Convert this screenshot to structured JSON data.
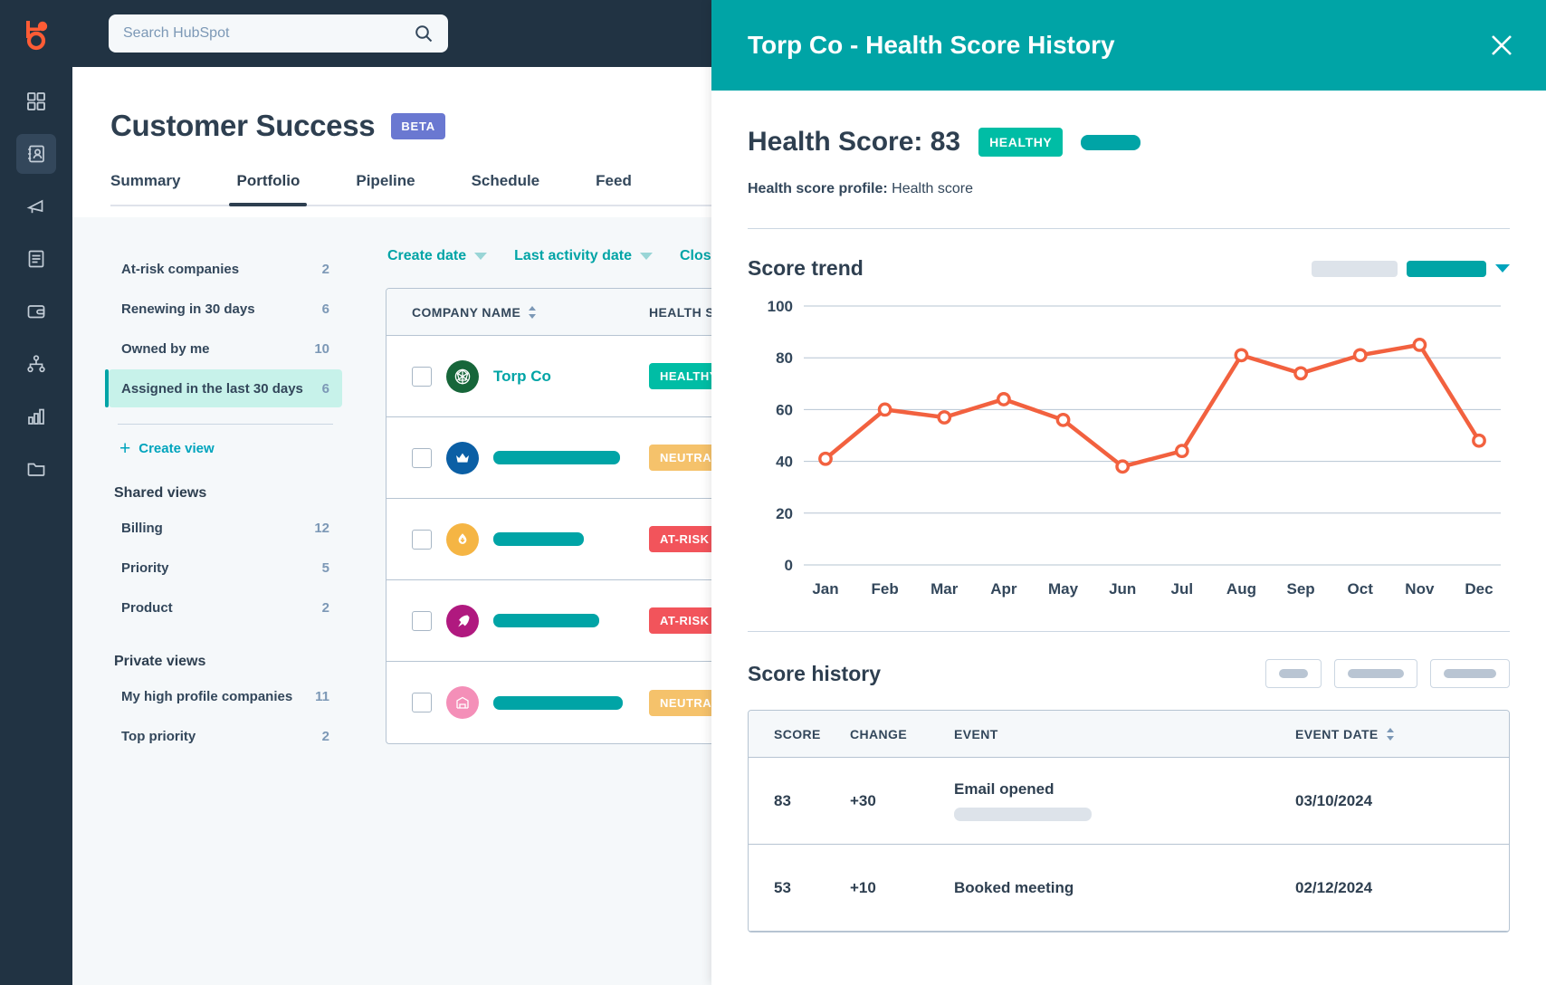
{
  "rail": {
    "logo": "hubspot-logo",
    "items": [
      {
        "name": "dashboard-icon",
        "label": "Dashboard"
      },
      {
        "name": "contacts-icon",
        "label": "Contacts"
      },
      {
        "name": "marketing-megaphone-icon",
        "label": "Marketing"
      },
      {
        "name": "content-icon",
        "label": "Content"
      },
      {
        "name": "commerce-wallet-icon",
        "label": "Commerce"
      },
      {
        "name": "automation-icon",
        "label": "Automation"
      },
      {
        "name": "reporting-bar-chart-icon",
        "label": "Reporting"
      },
      {
        "name": "library-folder-icon",
        "label": "Library"
      }
    ]
  },
  "search": {
    "placeholder": "Search HubSpot",
    "value": ""
  },
  "header": {
    "title": "Customer Success",
    "badge": "BETA"
  },
  "tabs": [
    {
      "label": "Summary",
      "active": false
    },
    {
      "label": "Portfolio",
      "active": true
    },
    {
      "label": "Pipeline",
      "active": false
    },
    {
      "label": "Schedule",
      "active": false
    },
    {
      "label": "Feed",
      "active": false
    }
  ],
  "views": {
    "standard": [
      {
        "label": "At-risk companies",
        "count": "2",
        "selected": false
      },
      {
        "label": "Renewing in 30 days",
        "count": "6",
        "selected": false
      },
      {
        "label": "Owned by me",
        "count": "10",
        "selected": false
      },
      {
        "label": "Assigned in the last 30 days",
        "count": "6",
        "selected": true
      }
    ],
    "create_view": "Create view",
    "shared_title": "Shared views",
    "shared": [
      {
        "label": "Billing",
        "count": "12"
      },
      {
        "label": "Priority",
        "count": "5"
      },
      {
        "label": "Product",
        "count": "2"
      }
    ],
    "private_title": "Private views",
    "private": [
      {
        "label": "My high profile companies",
        "count": "11"
      },
      {
        "label": "Top priority",
        "count": "2"
      }
    ]
  },
  "filters": [
    {
      "label": "Create date"
    },
    {
      "label": "Last activity date"
    },
    {
      "label": "Close date"
    }
  ],
  "table": {
    "columns": [
      {
        "label": "COMPANY NAME",
        "sortable": true
      },
      {
        "label": "HEALTH STATUS",
        "sortable": false
      }
    ],
    "rows": [
      {
        "company": "Torp Co",
        "redacted": false,
        "redact_width": 0,
        "avatar_color": "#17663a",
        "avatar_glyph": "◈",
        "status": "HEALTHY",
        "status_class": "healthy"
      },
      {
        "company": "",
        "redacted": true,
        "redact_width": 140,
        "avatar_color": "#0b5fa5",
        "avatar_glyph": "♛",
        "status": "NEUTRAL",
        "status_class": "neutral"
      },
      {
        "company": "",
        "redacted": true,
        "redact_width": 100,
        "avatar_color": "#f5b544",
        "avatar_glyph": "◉",
        "status": "AT-RISK",
        "status_class": "atrisk"
      },
      {
        "company": "",
        "redacted": true,
        "redact_width": 117,
        "avatar_color": "#b0197f",
        "avatar_glyph": "➤",
        "status": "AT-RISK",
        "status_class": "atrisk"
      },
      {
        "company": "",
        "redacted": true,
        "redact_width": 143,
        "avatar_color": "#f48fb8",
        "avatar_glyph": "▦",
        "status": "NEUTRAL",
        "status_class": "neutral"
      }
    ]
  },
  "panel": {
    "title": "Torp Co - Health Score History",
    "close_icon": "close-icon",
    "score_label": "Health Score: 83",
    "score_pill": "HEALTHY",
    "profile_label": "Health score profile:",
    "profile_value": "Health score",
    "trend_title": "Score trend",
    "history_title": "Score history",
    "history_columns": [
      {
        "label": "SCORE"
      },
      {
        "label": "CHANGE"
      },
      {
        "label": "EVENT"
      },
      {
        "label": "EVENT DATE",
        "sortable": true
      }
    ],
    "history_rows": [
      {
        "score": "83",
        "change": "+30",
        "event": "Email opened",
        "date": "03/10/2024",
        "redacted_sub": true
      },
      {
        "score": "53",
        "change": "+10",
        "event": "Booked meeting",
        "date": "02/12/2024",
        "redacted_sub": false
      }
    ]
  },
  "colors": {
    "teal": "#00a4a6",
    "healthy": "#00bda5",
    "neutral": "#f5c26b",
    "atrisk": "#f2545b",
    "beta": "#6a78d1",
    "line": "#f2613f",
    "navy": "#213343"
  },
  "chart_data": {
    "type": "line",
    "title": "Score trend",
    "xlabel": "",
    "ylabel": "",
    "categories": [
      "Jan",
      "Feb",
      "Mar",
      "Apr",
      "May",
      "Jun",
      "Jul",
      "Aug",
      "Sep",
      "Oct",
      "Nov",
      "Dec"
    ],
    "series": [
      {
        "name": "Health score",
        "color": "#f2613f",
        "values": [
          41,
          60,
          57,
          64,
          56,
          38,
          44,
          81,
          74,
          81,
          85,
          48
        ]
      }
    ],
    "yticks": [
      0,
      20,
      40,
      60,
      80,
      100
    ],
    "ylim": [
      0,
      100
    ],
    "grid": true,
    "legend": "none",
    "markers": true
  }
}
